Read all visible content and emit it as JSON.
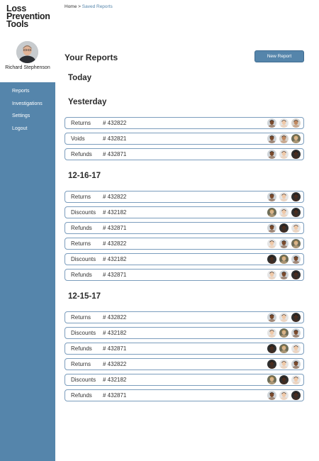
{
  "brand": {
    "logo_lines": [
      "oss",
      "Prevention",
      "Tools"
    ],
    "logo_first_letter": "L"
  },
  "user": {
    "name": "Richard Stephenson"
  },
  "nav": {
    "items": [
      "Reports",
      "Investigations",
      "Settings",
      "Logout"
    ]
  },
  "breadcrumb": {
    "home": "Home",
    "separator": ">",
    "current": "Saved Reports"
  },
  "page": {
    "title": "Your Reports",
    "new_report_label": "New Report"
  },
  "colors": {
    "accent": "#5585ab",
    "row_border": "#7b9dbd"
  },
  "sections": [
    {
      "heading": "Today",
      "rows": []
    },
    {
      "heading": "Yesterday",
      "rows": [
        {
          "type": "Returns",
          "number": "# 432822",
          "avatars": [
            "dark",
            "light",
            "medium"
          ]
        },
        {
          "type": "Voids",
          "number": "# 432821",
          "avatars": [
            "dark",
            "medium",
            "blonde"
          ]
        },
        {
          "type": "Refunds",
          "number": "# 432871",
          "avatars": [
            "dark",
            "light",
            "black"
          ]
        }
      ]
    },
    {
      "heading": "12-16-17",
      "rows": [
        {
          "type": "Returns",
          "number": "# 432822",
          "avatars": [
            "dark",
            "light",
            "black"
          ]
        },
        {
          "type": "Discounts",
          "number": "# 432182",
          "avatars": [
            "blonde",
            "light",
            "black"
          ]
        },
        {
          "type": "Refunds",
          "number": "# 432871",
          "avatars": [
            "dark",
            "black",
            "light"
          ]
        },
        {
          "type": "Returns",
          "number": "# 432822",
          "avatars": [
            "light",
            "dark",
            "blonde"
          ]
        },
        {
          "type": "Discounts",
          "number": "# 432182",
          "avatars": [
            "black",
            "blonde",
            "dark"
          ]
        },
        {
          "type": "Refunds",
          "number": "# 432871",
          "avatars": [
            "light",
            "dark",
            "black"
          ]
        }
      ]
    },
    {
      "heading": "12-15-17",
      "rows": [
        {
          "type": "Returns",
          "number": "# 432822",
          "avatars": [
            "dark",
            "light",
            "black"
          ]
        },
        {
          "type": "Discounts",
          "number": "# 432182",
          "avatars": [
            "light",
            "blonde",
            "dark"
          ]
        },
        {
          "type": "Refunds",
          "number": "# 432871",
          "avatars": [
            "black",
            "blonde",
            "light"
          ]
        },
        {
          "type": "Returns",
          "number": "# 432822",
          "avatars": [
            "black",
            "light",
            "dark"
          ]
        },
        {
          "type": "Discounts",
          "number": "# 432182",
          "avatars": [
            "blonde",
            "black",
            "light"
          ]
        },
        {
          "type": "Refunds",
          "number": "# 432871",
          "avatars": [
            "dark",
            "light",
            "black"
          ]
        }
      ]
    }
  ]
}
